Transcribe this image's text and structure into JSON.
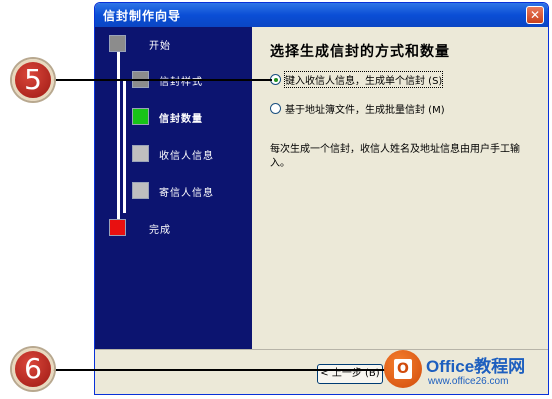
{
  "dialog": {
    "title": "信封制作向导",
    "close_glyph": "✕"
  },
  "steps": [
    {
      "label": "开始",
      "color": "#8c8c8c"
    },
    {
      "label": "信封样式",
      "color": "#8c8c8c"
    },
    {
      "label": "信封数量",
      "color": "#18c418"
    },
    {
      "label": "收信人信息",
      "color": "#bfbfbf"
    },
    {
      "label": "寄信人信息",
      "color": "#bfbfbf"
    },
    {
      "label": "完成",
      "color": "#e81010"
    }
  ],
  "content": {
    "heading": "选择生成信封的方式和数量",
    "options": [
      {
        "label": "键入收信人信息，生成单个信封 (S)",
        "checked": true
      },
      {
        "label": "基于地址簿文件，生成批量信封 (M)",
        "checked": false
      }
    ],
    "description": "每次生成一个信封，收信人姓名及地址信息由用户手工输入。"
  },
  "buttons": {
    "prev_label": "< 上一步 (B)"
  },
  "callouts": [
    "5",
    "6"
  ],
  "watermark": {
    "logo_letter": "O",
    "title": "Office教程网",
    "url": "www.office26.com"
  }
}
